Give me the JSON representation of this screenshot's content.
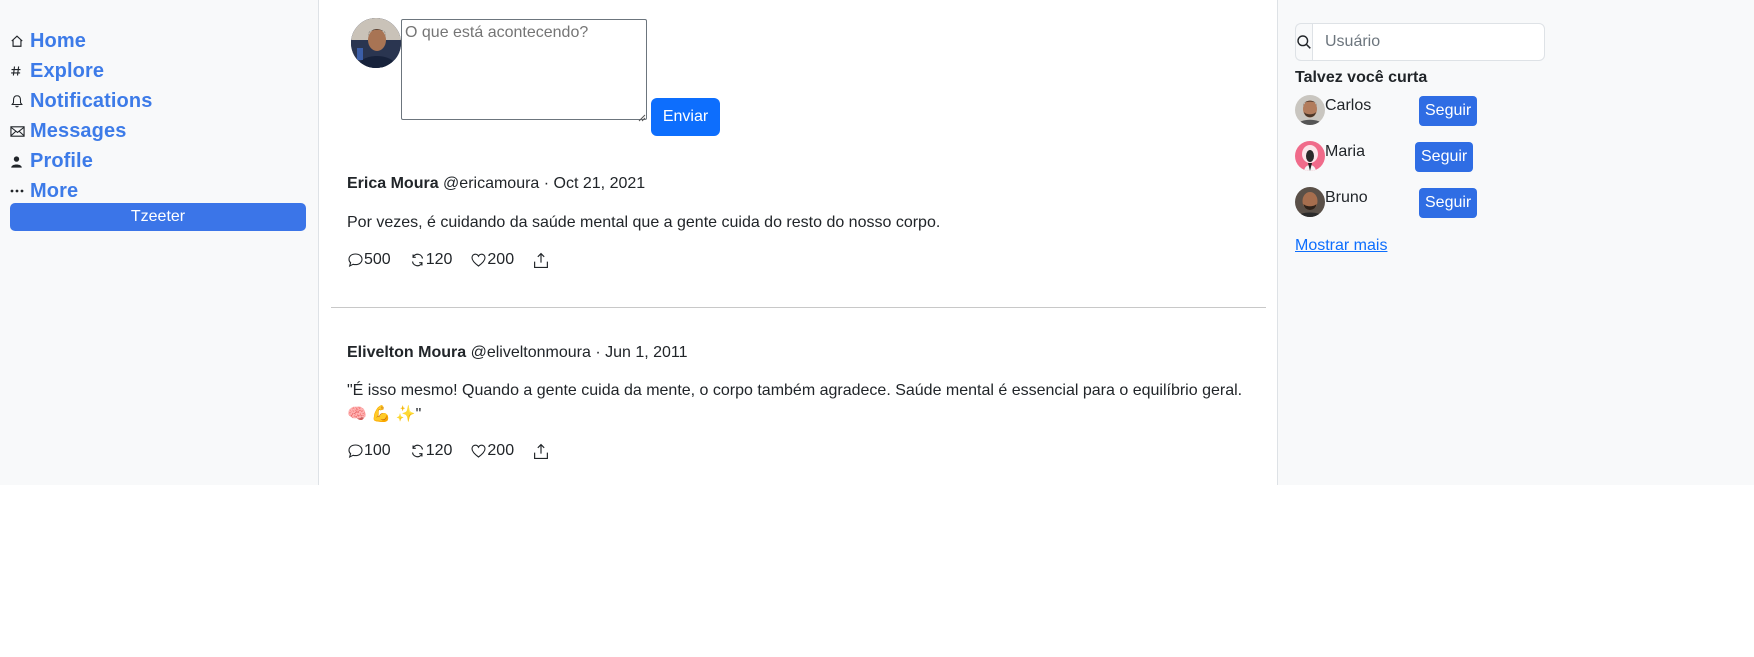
{
  "nav": {
    "items": [
      {
        "label": "Home",
        "icon": "home-icon"
      },
      {
        "label": "Explore",
        "icon": "hash-icon"
      },
      {
        "label": "Notifications",
        "icon": "bell-icon"
      },
      {
        "label": "Messages",
        "icon": "envelope-icon"
      },
      {
        "label": "Profile",
        "icon": "person-icon"
      },
      {
        "label": "More",
        "icon": "ellipsis-icon"
      }
    ],
    "tzeeter_label": "Tzeeter"
  },
  "compose": {
    "placeholder": "O que está acontecendo?",
    "send_label": "Enviar"
  },
  "tweets": [
    {
      "name": "Erica Moura",
      "meta": "@ericamoura · Oct 21, 2021",
      "text": "Por vezes, é cuidando da saúde mental que a gente cuida do resto do nosso corpo.",
      "comments": "500",
      "retweets": "120",
      "likes": "200"
    },
    {
      "name": "Elivelton Moura",
      "meta": "@eliveltonmoura · Jun 1, 2011",
      "text_line1": "\"É isso mesmo! Quando a gente cuida da mente, o corpo também agradece. Saúde mental é essencial para o equilíbrio geral.",
      "text_line2": "🧠 💪 ✨\"",
      "comments": "100",
      "retweets": "120",
      "likes": "200"
    }
  ],
  "right": {
    "search_placeholder": "Usuário",
    "suggest_title": "Talvez você curta",
    "suggestions": [
      {
        "name": "Carlos",
        "follow": "Seguir"
      },
      {
        "name": "Maria",
        "follow": "Seguir"
      },
      {
        "name": "Bruno",
        "follow": "Seguir"
      }
    ],
    "show_more": "Mostrar mais"
  },
  "colors": {
    "accent": "#0d6efd",
    "nav_link": "#3d7be8",
    "sidebar_bg": "#f8f9fa"
  }
}
